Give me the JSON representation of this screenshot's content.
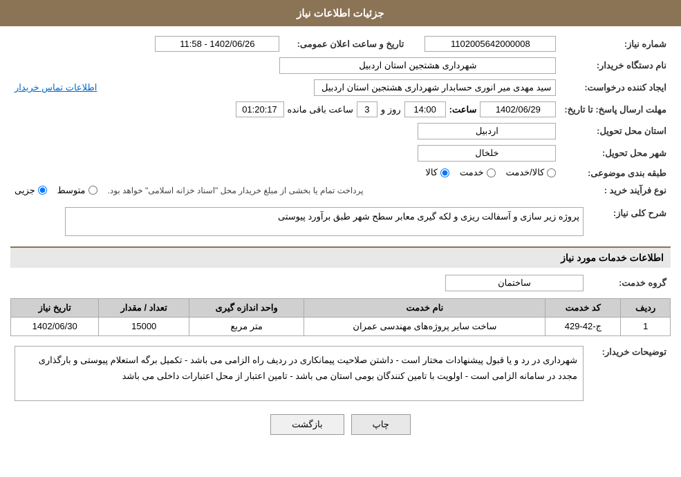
{
  "header": {
    "title": "جزئیات اطلاعات نیاز"
  },
  "fields": {
    "need_number_label": "شماره نیاز:",
    "need_number_value": "1102005642000008",
    "buyer_org_label": "نام دستگاه خریدار:",
    "buyer_org_value": "شهرداری هشتجین استان اردبیل",
    "announce_date_label": "تاریخ و ساعت اعلان عمومی:",
    "announce_date_value": "1402/06/26 - 11:58",
    "creator_label": "ایجاد کننده درخواست:",
    "creator_value": "سید مهدی میر انوری حسابدار شهرداری هشتجین استان اردبیل",
    "contact_link": "اطلاعات تماس خریدار",
    "deadline_label": "مهلت ارسال پاسخ: تا تاریخ:",
    "deadline_date": "1402/06/29",
    "deadline_time_label": "ساعت:",
    "deadline_time": "14:00",
    "deadline_days_label": "روز و",
    "deadline_days": "3",
    "deadline_remaining_label": "ساعت باقی مانده",
    "deadline_remaining": "01:20:17",
    "province_label": "استان محل تحویل:",
    "province_value": "اردبیل",
    "city_label": "شهر محل تحویل:",
    "city_value": "خلخال",
    "category_label": "طبقه بندی موضوعی:",
    "category_options": [
      "کالا",
      "خدمت",
      "کالا/خدمت"
    ],
    "category_selected": "کالا",
    "purchase_type_label": "نوع فرآیند خرید :",
    "purchase_type_options": [
      "جزیی",
      "متوسط"
    ],
    "purchase_type_note": "پرداخت تمام یا بخشی از مبلغ خریدار محل \"اسناد خزانه اسلامی\" خواهد بود.",
    "need_description_label": "شرح کلی نیاز:",
    "need_description_value": "پروژه زیر سازی و آسفالت ریزی و لکه گیری معابر سطح شهر طبق برآورد پیوستی",
    "services_section_label": "اطلاعات خدمات مورد نیاز",
    "service_group_label": "گروه خدمت:",
    "service_group_value": "ساختمان",
    "services_table": {
      "columns": [
        "ردیف",
        "کد خدمت",
        "نام خدمت",
        "واحد اندازه گیری",
        "تعداد / مقدار",
        "تاریخ نیاز"
      ],
      "rows": [
        {
          "row_num": "1",
          "service_code": "ج-42-429",
          "service_name": "ساخت سایر پروژه‌های مهندسی عمران",
          "unit": "متر مربع",
          "quantity": "15000",
          "date": "1402/06/30"
        }
      ]
    },
    "notes_label": "توضیحات خریدار:",
    "notes_value": "شهرداری در رد و یا قبول پیشنهادات مختار است - داشتن صلاحیت پیمانکاری در ردیف راه الزامی می باشد - تکمیل برگه استعلام پیوستی و بارگذاری مجدد در سامانه الزامی است - اولویت با تامین کنندگان بومی استان می باشد - تامین اعتبار از محل اعتبارات داخلی می باشد"
  },
  "buttons": {
    "back_label": "بازگشت",
    "print_label": "چاپ"
  }
}
